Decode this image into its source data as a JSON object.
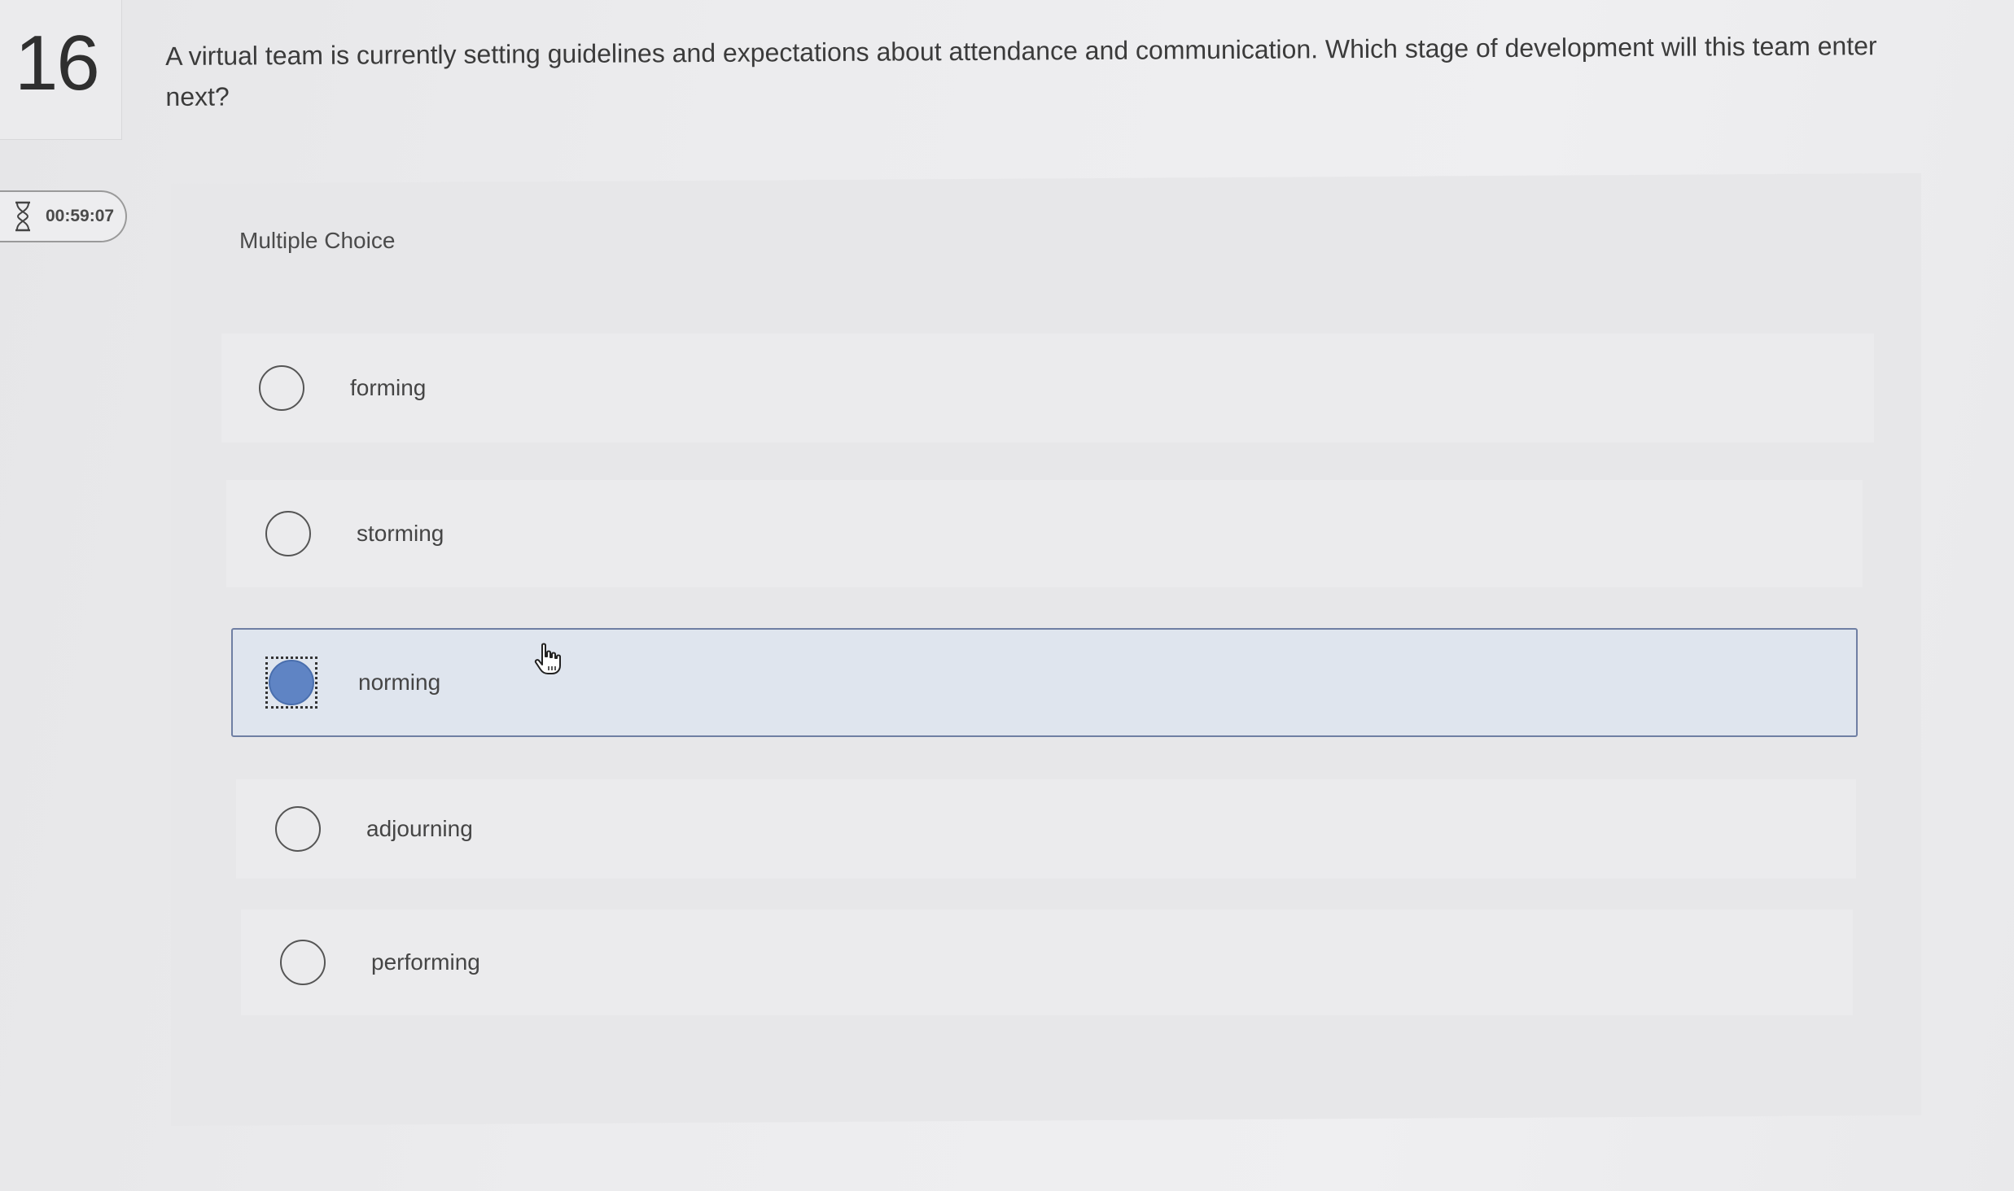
{
  "question": {
    "number": "16",
    "text": "A virtual team is currently setting guidelines and expectations about attendance and communication. Which stage of development will this team enter next?"
  },
  "timer": {
    "icon": "hourglass-icon",
    "remaining": "00:59:07"
  },
  "panel": {
    "type_label": "Multiple Choice"
  },
  "options": [
    {
      "label": "forming",
      "selected": false
    },
    {
      "label": "storming",
      "selected": false
    },
    {
      "label": "norming",
      "selected": true
    },
    {
      "label": "adjourning",
      "selected": false
    },
    {
      "label": "performing",
      "selected": false
    }
  ],
  "colors": {
    "selected_fill": "#5f84c4",
    "selected_background": "#dfe5ee",
    "selected_border": "#6f7fa3"
  }
}
